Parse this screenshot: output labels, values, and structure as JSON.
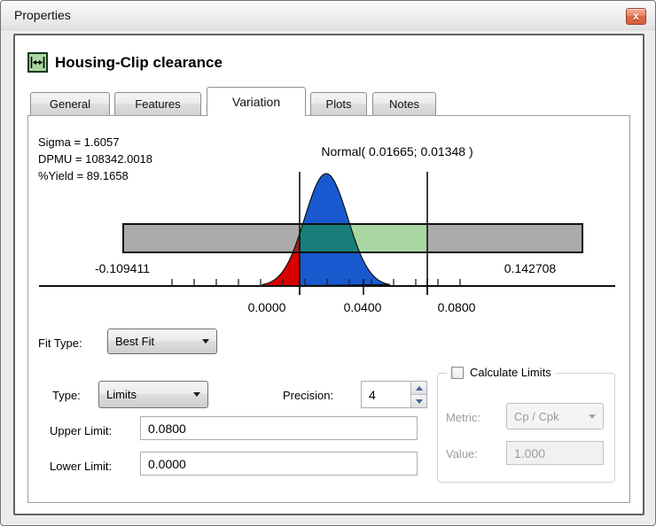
{
  "window": {
    "title": "Properties",
    "close_glyph": "x"
  },
  "header": {
    "title": "Housing-Clip clearance",
    "icon": "clearance-dimension-icon"
  },
  "tabs": [
    {
      "label": "General",
      "active": false
    },
    {
      "label": "Features",
      "active": false
    },
    {
      "label": "Variation",
      "active": true
    },
    {
      "label": "Plots",
      "active": false
    },
    {
      "label": "Notes",
      "active": false
    }
  ],
  "variation": {
    "stats": [
      {
        "text": "Sigma = 1.6057"
      },
      {
        "text": "DPMU = 108342.0018"
      },
      {
        "text": "%Yield = 89.1658"
      }
    ],
    "chart": {
      "type": "distribution",
      "distribution_label": "Normal( 0.01665; 0.01348 )",
      "normal": {
        "mean": 0.01665,
        "sd": 0.01348
      },
      "limits": {
        "lower": 0.0,
        "upper": 0.08
      },
      "ticks": [
        {
          "value": 0.0,
          "label": "0.0000"
        },
        {
          "value": 0.04,
          "label": "0.0400"
        },
        {
          "value": 0.08,
          "label": "0.0800"
        }
      ],
      "range_min": "-0.109411",
      "range_max": "0.142708",
      "colors": {
        "curve_blue": "#1859d0",
        "out_of_spec_red": "#d90000",
        "overlap_teal": "#187e79",
        "in_spec_green": "#a9d7a1",
        "bar_gray": "#ababab",
        "dark_red_overlap": "#9b2121"
      }
    },
    "fit_type": {
      "label": "Fit Type:",
      "value": "Best Fit"
    },
    "type": {
      "label": "Type:",
      "value": "Limits"
    },
    "precision": {
      "label": "Precision:",
      "value": "4"
    },
    "upper_limit": {
      "label": "Upper Limit:",
      "value": "0.0800"
    },
    "lower_limit": {
      "label": "Lower Limit:",
      "value": "0.0000"
    },
    "calculate_limits": {
      "title": "Calculate Limits",
      "checked": false,
      "metric": {
        "label": "Metric:",
        "value": "Cp / Cpk"
      },
      "value": {
        "label": "Value:",
        "value": "1.000"
      }
    }
  }
}
